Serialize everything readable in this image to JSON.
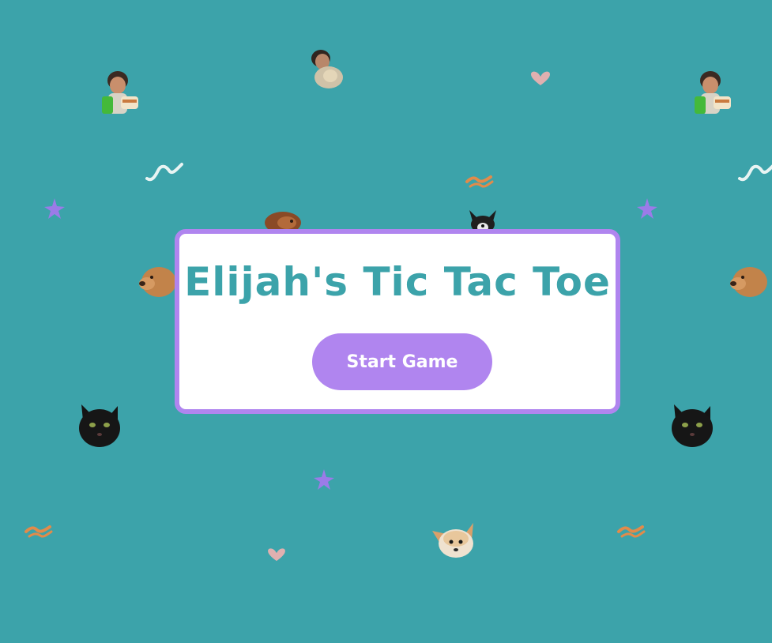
{
  "game": {
    "title": "Elijah's Tic Tac Toe",
    "start_label": "Start Game"
  },
  "background": {
    "color": "#3ca3aa",
    "stickers": [
      "kid-with-cup-sticker",
      "kid-with-toy-sticker",
      "brown-dog-sticker",
      "black-white-dog-sticker",
      "black-cat-sticker",
      "chihuahua-sticker",
      "purple-star-doodle",
      "squiggle-doodle",
      "heart-doodle"
    ]
  },
  "colors": {
    "accent": "#b085ef",
    "panel": "#ffffff",
    "title": "#3ca3aa"
  }
}
